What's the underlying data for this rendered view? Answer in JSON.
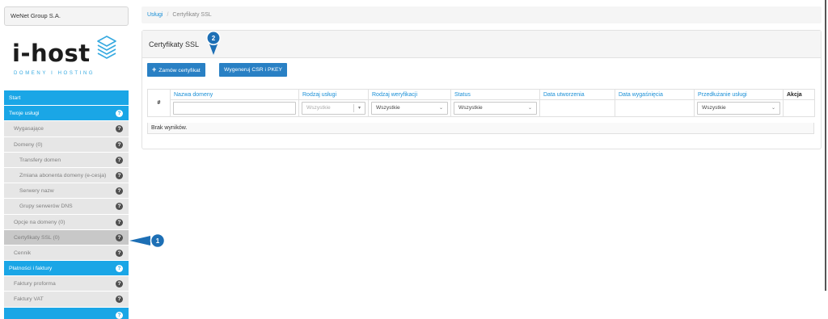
{
  "company": "WeNet Group S.A.",
  "logo": {
    "name": "i-host",
    "tagline": "DOMENY I HOSTING",
    "icon": "layers-icon"
  },
  "sidebar": {
    "items": [
      {
        "label": "Start",
        "style": "blue",
        "icon": false
      },
      {
        "label": "Twoje usługi",
        "style": "blue",
        "icon": true
      },
      {
        "label": "Wygasające",
        "style": "grey",
        "icon": true
      },
      {
        "label": "Domeny (0)",
        "style": "grey",
        "icon": true
      },
      {
        "label": "Transfery domen",
        "style": "grey-l2",
        "icon": true
      },
      {
        "label": "Zmiana abonenta domeny (e-cesja)",
        "style": "grey-l2",
        "icon": true
      },
      {
        "label": "Serwery nazw",
        "style": "grey-l2",
        "icon": true
      },
      {
        "label": "Grupy serwerów DNS",
        "style": "grey-l2",
        "icon": true
      },
      {
        "label": "Opcje na domeny (0)",
        "style": "grey",
        "icon": true
      },
      {
        "label": "Certyfikaty SSL (0)",
        "style": "grey-active",
        "icon": true
      },
      {
        "label": "Cennik",
        "style": "grey",
        "icon": true
      },
      {
        "label": "Płatności i faktury",
        "style": "blue",
        "icon": true
      },
      {
        "label": "Faktury proforma",
        "style": "grey",
        "icon": true
      },
      {
        "label": "Faktury VAT",
        "style": "grey",
        "icon": true
      },
      {
        "label": "",
        "style": "blue",
        "icon": true
      }
    ]
  },
  "markers": {
    "m1": "1",
    "m2": "2"
  },
  "breadcrumb": {
    "link": "Usługi",
    "sep": "/",
    "current": "Certyfikaty SSL"
  },
  "panel": {
    "title": "Certyfikaty SSL",
    "order_button": "Zamów certyfikat",
    "csr_button": "Wygeneruj CSR i PKEY"
  },
  "table": {
    "columns": {
      "hash": "#",
      "domain": "Nazwa domeny",
      "service_type": "Rodzaj usługi",
      "verification": "Rodzaj weryfikacji",
      "status": "Status",
      "created": "Data utworzenia",
      "expires": "Data wygaśnięcia",
      "renewal": "Przedłużanie usługi",
      "action": "Akcja"
    },
    "filters": {
      "domain": "",
      "service_type": "Wszystkie",
      "verification": "Wszystkie",
      "status": "Wszystkie",
      "renewal": "Wszystkie"
    },
    "empty": "Brak wyników."
  },
  "colors": {
    "accent": "#1aa6e6",
    "button": "#2980c4",
    "marker": "#1d6fb5"
  }
}
